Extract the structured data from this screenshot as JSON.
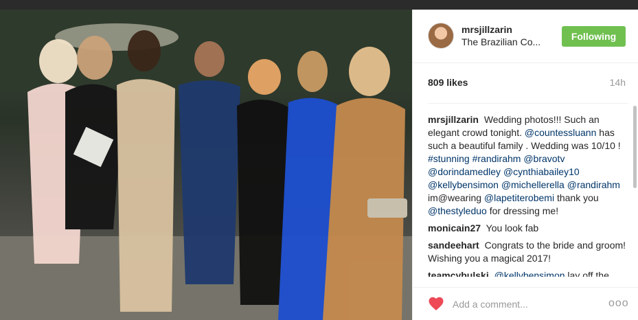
{
  "post": {
    "username": "mrsjillzarin",
    "location": "The Brazilian Co...",
    "follow_label": "Following",
    "likes": "809 likes",
    "age": "14h",
    "comments": [
      {
        "user": "mrsjillzarin",
        "text_parts": [
          "Wedding photos!!! Such an elegant crowd tonight. ",
          "@countessluann",
          " has such a beautiful family . Wedding was 10/10 ! ",
          "#stunning",
          " ",
          "#randirahm",
          " ",
          "@bravotv",
          " ",
          "@dorindamedley",
          " ",
          "@cynthiabailey10",
          " ",
          "@kellybensimon",
          " ",
          "@michellerella",
          " ",
          "@randirahm",
          " im@wearing ",
          "@lapetiterobemi",
          " thank you ",
          "@thestyleduo",
          " for dressing me!"
        ]
      },
      {
        "user": "monicain27",
        "text_parts": [
          "You look fab"
        ]
      },
      {
        "user": "sandeehart",
        "text_parts": [
          "Congrats to the bride and groom! Wishing you a magical 2017!"
        ]
      },
      {
        "user": "teamcybulski",
        "text_parts": [
          "@kellybensimon",
          " lay off the"
        ]
      }
    ],
    "comment_placeholder": "Add a comment...",
    "more_label": "ooo"
  },
  "icons": {
    "avatar": "profile-avatar",
    "like": "heart-icon",
    "more": "more-options-icon"
  },
  "colors": {
    "follow_button": "#70c050",
    "heart": "#ed4956",
    "link": "#003569"
  }
}
